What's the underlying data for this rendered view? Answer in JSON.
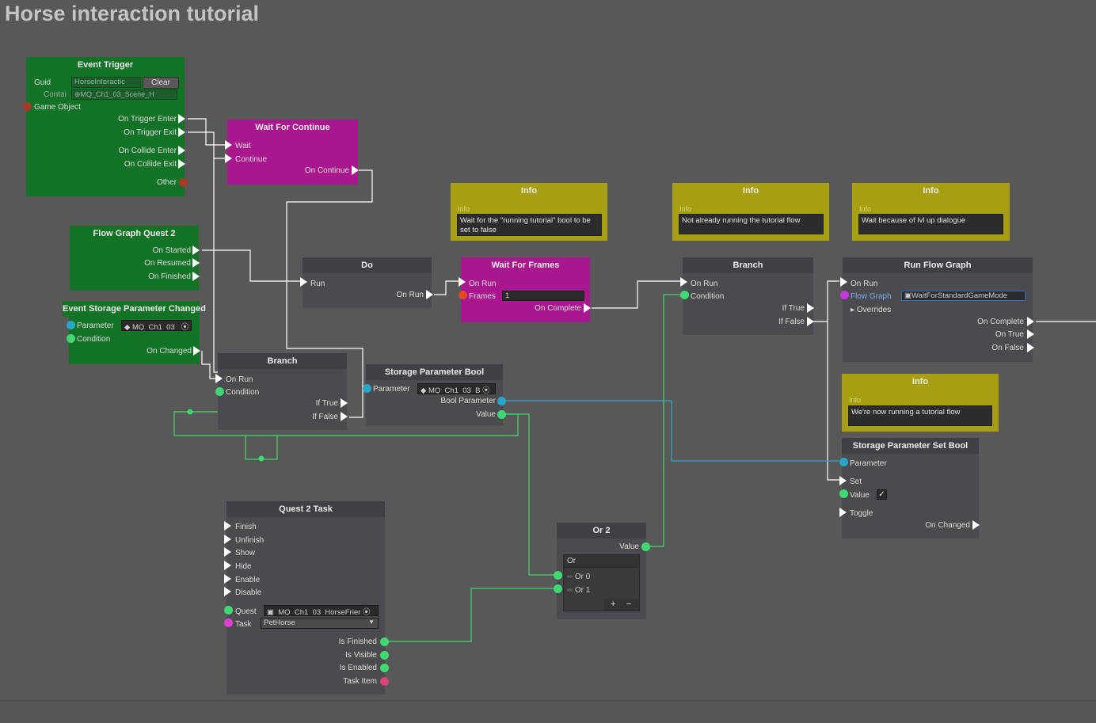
{
  "title": "Horse interaction tutorial",
  "event_trigger": {
    "title": "Event Trigger",
    "guid_label": "Guid",
    "guid_value": "HorseInteractic",
    "clear_label": "Clear",
    "contai_label": "Contai",
    "contai_value": "MQ_Ch1_03_Scene_H",
    "game_object_label": "Game Object",
    "outputs": [
      "On Trigger Enter",
      "On Trigger Exit",
      "On Collide Enter",
      "On Collide Exit",
      "Other"
    ]
  },
  "wait_for_continue": {
    "title": "Wait For Continue",
    "in_wait": "Wait",
    "in_continue": "Continue",
    "out_continue": "On Continue"
  },
  "flow_graph_quest": {
    "title": "Flow Graph Quest 2",
    "outputs": [
      "On Started",
      "On Resumed",
      "On Finished"
    ]
  },
  "event_storage": {
    "title": "Event Storage Parameter Changed",
    "parameter_label": "Parameter",
    "parameter_value": "MQ_Ch1_03_",
    "condition_label": "Condition",
    "on_changed": "On Changed"
  },
  "do_node": {
    "title": "Do",
    "run": "Run",
    "on_run": "On Run"
  },
  "wait_for_frames": {
    "title": "Wait For Frames",
    "on_run": "On Run",
    "frames_label": "Frames",
    "frames_value": "1",
    "on_complete": "On Complete"
  },
  "branch1": {
    "title": "Branch",
    "on_run": "On Run",
    "condition": "Condition",
    "if_true": "If True",
    "if_false": "If False"
  },
  "branch2": {
    "title": "Branch",
    "on_run": "On Run",
    "condition": "Condition",
    "if_true": "If True",
    "if_false": "If False"
  },
  "storage_param_bool": {
    "title": "Storage Parameter Bool",
    "parameter_label": "Parameter",
    "parameter_value": "MQ_Ch1_03_B",
    "bool_parameter": "Bool Parameter",
    "value": "Value"
  },
  "run_flow_graph": {
    "title": "Run Flow Graph",
    "on_run": "On Run",
    "flow_graph_label": "Flow Graph",
    "flow_graph_value": "WaitForStandardGameMode",
    "overrides": "Overrides",
    "outputs": [
      "On Complete",
      "On True",
      "On False"
    ]
  },
  "info1": {
    "title": "Info",
    "label": "Info",
    "text": "Wait for the \"running tutorial\" bool to be set to false"
  },
  "info2": {
    "title": "Info",
    "label": "Info",
    "text": "Not already running the tutorial flow"
  },
  "info3": {
    "title": "Info",
    "label": "Info",
    "text": "Wait because of lvl up dialogue"
  },
  "info4": {
    "title": "Info",
    "label": "Info",
    "text": "We're now running a tutorial flow"
  },
  "storage_set_bool": {
    "title": "Storage Parameter Set Bool",
    "parameter": "Parameter",
    "set": "Set",
    "value": "Value",
    "toggle": "Toggle",
    "on_changed": "On Changed"
  },
  "quest_task": {
    "title": "Quest 2 Task",
    "inputs": [
      "Finish",
      "Unfinish",
      "Show",
      "Hide",
      "Enable",
      "Disable"
    ],
    "quest_label": "Quest",
    "quest_value": "_MQ_Ch1_03_HorseFrier",
    "task_label": "Task",
    "task_value": "PetHorse",
    "outputs": [
      "Is Finished",
      "Is Visible",
      "Is Enabled",
      "Task Item"
    ]
  },
  "or_node": {
    "title": "Or 2",
    "value": "Value",
    "list_header": "Or",
    "items": [
      "Or 0",
      "Or 1"
    ],
    "add": "+",
    "remove": "−"
  },
  "colors": {
    "bg": "#585858",
    "green": "#127326",
    "magenta": "#a8178e",
    "yellow": "#a6a010",
    "gray": "#494b4f",
    "bool_port": "#3fd872",
    "param_port": "#2aa6c4",
    "object_port": "#a33a2a",
    "flowgraph_port": "#c43ad8",
    "task_port": "#d8447a"
  }
}
